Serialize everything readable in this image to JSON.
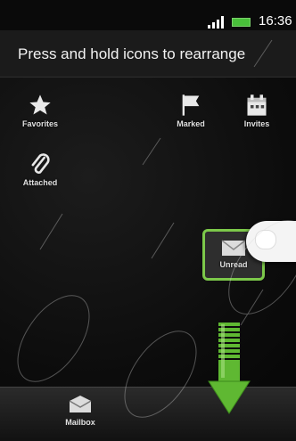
{
  "status_bar": {
    "time": "16:36",
    "signal_icon": "signal-icon",
    "battery_icon": "battery-icon"
  },
  "header": {
    "title": "Press and hold icons to rearrange"
  },
  "icons": {
    "favorites": {
      "label": "Favorites",
      "icon": "star-icon"
    },
    "marked": {
      "label": "Marked",
      "icon": "flag-icon"
    },
    "invites": {
      "label": "Invites",
      "icon": "calendar-icon"
    },
    "attached": {
      "label": "Attached",
      "icon": "paperclip-icon"
    },
    "unread": {
      "label": "Unread",
      "icon": "envelope-icon"
    }
  },
  "bottom_bar": {
    "mailbox": {
      "label": "Mailbox",
      "icon": "mail-icon"
    }
  },
  "colors": {
    "highlight": "#7cc84a",
    "arrow": "#5fb832",
    "battery": "#49c03a"
  }
}
